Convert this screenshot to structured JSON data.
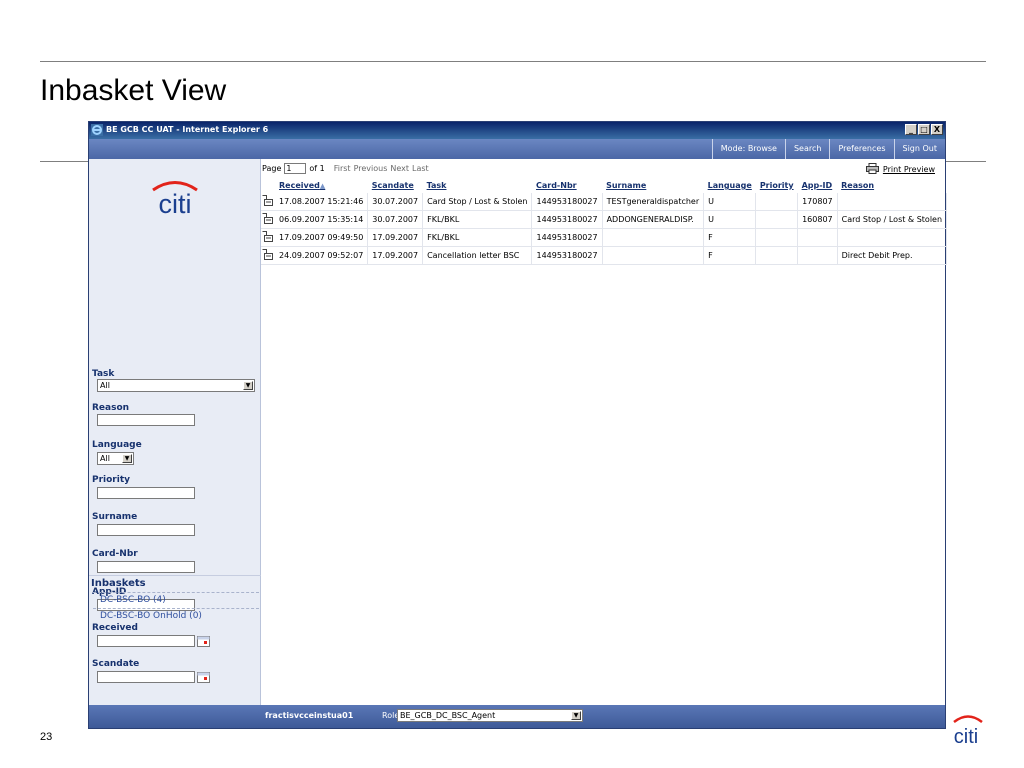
{
  "slide": {
    "title": "Inbasket View",
    "page_number": "23"
  },
  "window": {
    "title": "BE GCB CC UAT - Internet Explorer 6",
    "buttons": {
      "minimize": "_",
      "maximize": "□",
      "close": "X"
    }
  },
  "topnav": {
    "mode": "Mode: Browse",
    "search": "Search",
    "preferences": "Preferences",
    "signout": "Sign Out"
  },
  "filters": {
    "task": {
      "label": "Task",
      "value": "All"
    },
    "reason": {
      "label": "Reason",
      "value": ""
    },
    "language": {
      "label": "Language",
      "value": "All"
    },
    "priority": {
      "label": "Priority",
      "value": ""
    },
    "surname": {
      "label": "Surname",
      "value": ""
    },
    "cardnbr": {
      "label": "Card-Nbr",
      "value": ""
    },
    "appid": {
      "label": "App-ID",
      "value": ""
    },
    "received": {
      "label": "Received",
      "value": ""
    },
    "scandate": {
      "label": "Scandate",
      "value": ""
    }
  },
  "inbaskets": {
    "title": "Inbaskets",
    "items": [
      "DC-BSC-BO (4)",
      "DC-BSC-BO OnHold (0)"
    ]
  },
  "pager": {
    "page_label": "Page",
    "page_value": "1",
    "of": "of 1",
    "first": "First",
    "previous": "Previous",
    "next": "Next",
    "last": "Last"
  },
  "print_preview": "Print Preview",
  "table": {
    "sort_indicator": "▲",
    "columns": [
      "Received",
      "Scandate",
      "Task",
      "Card-Nbr",
      "Surname",
      "Language",
      "Priority",
      "App-ID",
      "Reason"
    ],
    "rows": [
      [
        "17.08.2007 15:21:46",
        "30.07.2007",
        "Card Stop / Lost & Stolen",
        "144953180027",
        "TESTgeneraldispatcher",
        "U",
        "",
        "170807",
        ""
      ],
      [
        "06.09.2007 15:35:14",
        "30.07.2007",
        "FKL/BKL",
        "144953180027",
        "ADDONGENERALDISP.",
        "U",
        "",
        "160807",
        "Card Stop / Lost & Stolen"
      ],
      [
        "17.09.2007 09:49:50",
        "17.09.2007",
        "FKL/BKL",
        "144953180027",
        "",
        "F",
        "",
        "",
        ""
      ],
      [
        "24.09.2007 09:52:07",
        "17.09.2007",
        "Cancellation letter BSC",
        "144953180027",
        "",
        "F",
        "",
        "",
        "Direct Debit Prep."
      ]
    ]
  },
  "statusbar": {
    "user": "fractisvcceinstua01",
    "role_label": "Role:",
    "role_value": "BE_GCB_DC_BSC_Agent"
  },
  "colors": {
    "titlebar": "#0a246a",
    "navbar": "#5b77b4",
    "sidebar": "#e8ecf5",
    "label": "#17326e",
    "link": "#2f4f9e",
    "citi_red": "#e2231a",
    "citi_blue": "#1b3f8f"
  }
}
